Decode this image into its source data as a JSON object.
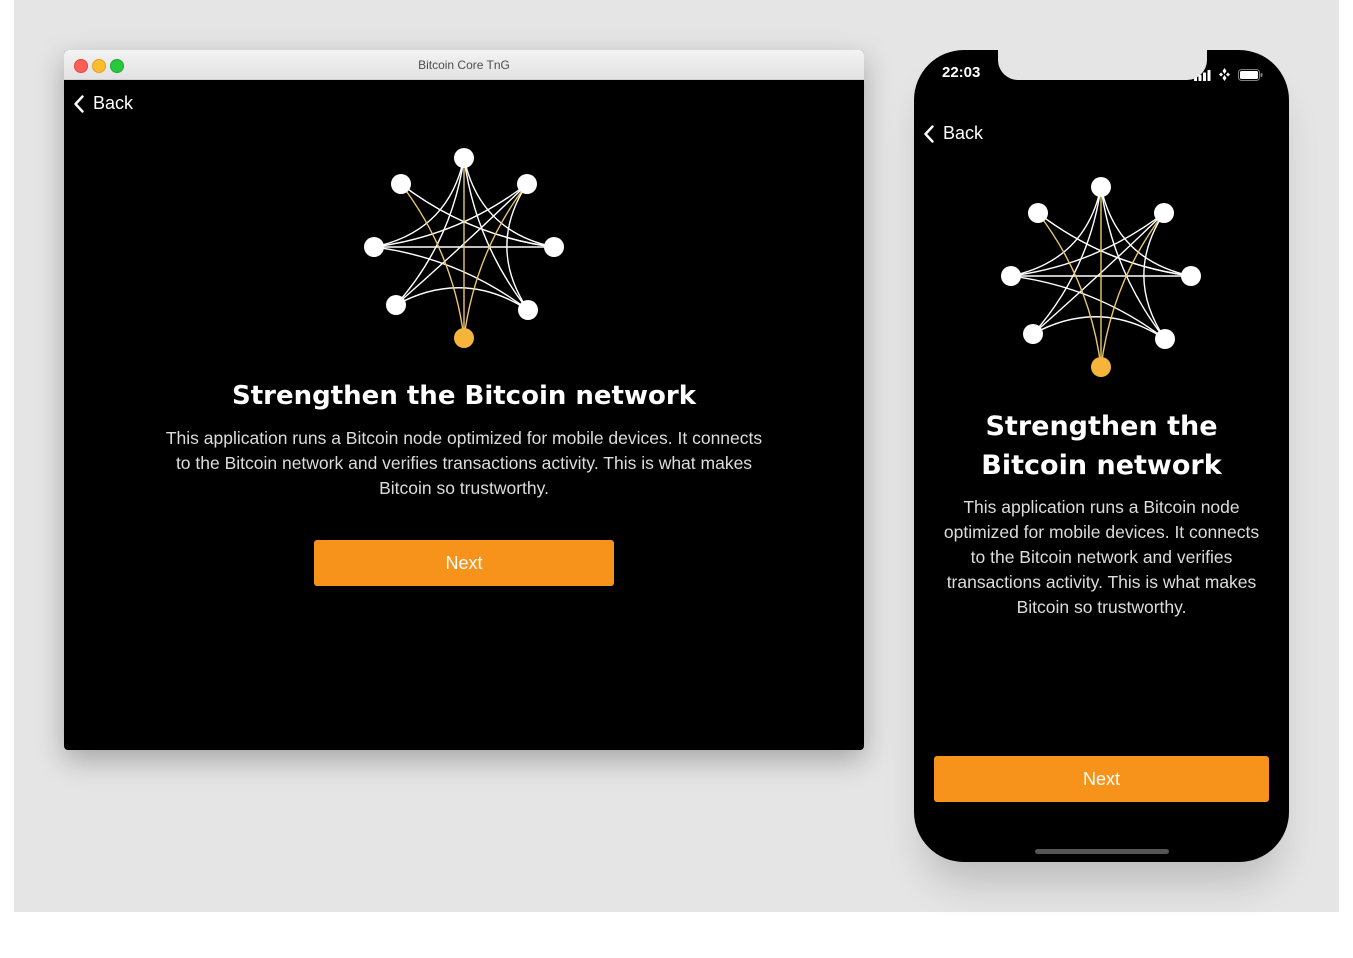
{
  "desktop": {
    "window_title": "Bitcoin Core TnG",
    "back_label": "Back",
    "headline": "Strengthen the Bitcoin network",
    "description": "This application runs a Bitcoin node optimized for mobile devices. It connects to the Bitcoin network and verifies transactions activity. This is what makes Bitcoin so trustworthy.",
    "next_label": "Next"
  },
  "mobile": {
    "status_time": "22:03",
    "back_label": "Back",
    "headline": "Strengthen the Bitcoin network",
    "description": "This application runs a Bitcoin node optimized for mobile devices. It connects to the Bitcoin network and verifies transactions activity. This is what makes Bitcoin so trustworthy.",
    "next_label": "Next"
  },
  "colors": {
    "accent": "#f7931a",
    "node_highlight": "#f5b53a",
    "background": "#000000",
    "canvas": "#e5e5e5"
  },
  "icons": {
    "back": "chevron-left-icon",
    "signal": "signal-bars-icon",
    "wifi": "wifi-icon",
    "battery": "battery-icon"
  }
}
